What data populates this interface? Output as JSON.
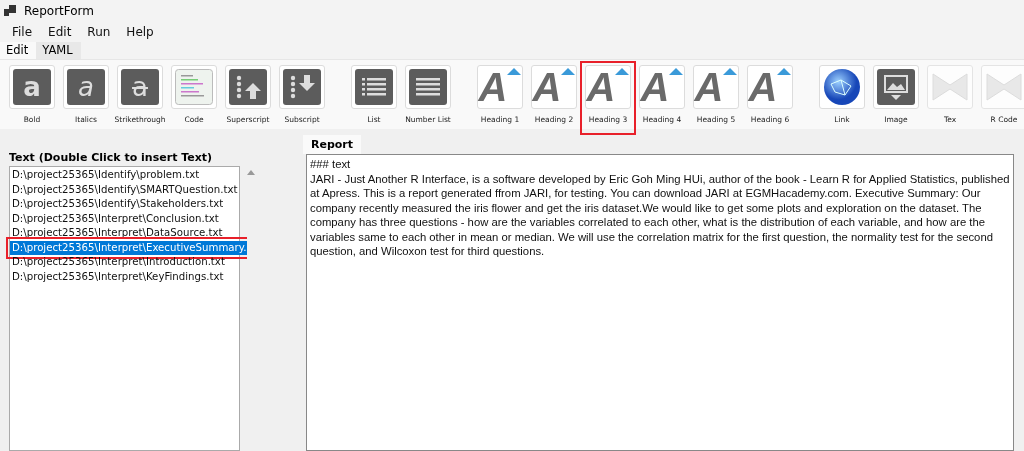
{
  "window": {
    "title": "ReportForm"
  },
  "menu": [
    "File",
    "Edit",
    "Run",
    "Help"
  ],
  "tabs": [
    {
      "label": "Edit",
      "selected": true
    },
    {
      "label": "YAML",
      "selected": false
    }
  ],
  "toolbar": [
    [
      {
        "kind": "bold",
        "glyph": "a",
        "label": "Bold",
        "highlighted": false
      },
      {
        "kind": "italic",
        "glyph": "a",
        "label": "Italics",
        "highlighted": false
      },
      {
        "kind": "strike",
        "glyph": "a",
        "label": "Strikethrough",
        "highlighted": false
      },
      {
        "kind": "code",
        "label": "Code",
        "highlighted": false
      },
      {
        "kind": "superscript",
        "label": "Superscript",
        "highlighted": false
      },
      {
        "kind": "subscript",
        "label": "Subscript",
        "highlighted": false
      }
    ],
    [
      {
        "kind": "list",
        "label": "List",
        "highlighted": false
      },
      {
        "kind": "numberlist",
        "label": "Number List",
        "highlighted": false
      }
    ],
    [
      {
        "kind": "heading",
        "glyph": "A",
        "label": "Heading 1",
        "highlighted": false
      },
      {
        "kind": "heading",
        "glyph": "A",
        "label": "Heading 2",
        "highlighted": false
      },
      {
        "kind": "heading",
        "glyph": "A",
        "label": "Heading 3",
        "highlighted": true
      },
      {
        "kind": "heading",
        "glyph": "A",
        "label": "Heading 4",
        "highlighted": false
      },
      {
        "kind": "heading",
        "glyph": "A",
        "label": "Heading 5",
        "highlighted": false
      },
      {
        "kind": "heading",
        "glyph": "A",
        "label": "Heading 6",
        "highlighted": false
      }
    ],
    [
      {
        "kind": "link",
        "label": "Link",
        "highlighted": false
      },
      {
        "kind": "image",
        "label": "Image",
        "highlighted": false
      },
      {
        "kind": "tex",
        "label": "Tex",
        "highlighted": false
      },
      {
        "kind": "tex",
        "label": "R Code",
        "highlighted": false
      }
    ]
  ],
  "text_panel": {
    "title": "Text (Double Click to insert Text)",
    "items": [
      {
        "label": "D:\\project25365\\Identify\\problem.txt",
        "selected": false,
        "highlighted": false
      },
      {
        "label": "D:\\project25365\\Identify\\SMARTQuestion.txt",
        "selected": false,
        "highlighted": false
      },
      {
        "label": "D:\\project25365\\Identify\\Stakeholders.txt",
        "selected": false,
        "highlighted": false
      },
      {
        "label": "D:\\project25365\\Interpret\\Conclusion.txt",
        "selected": false,
        "highlighted": false
      },
      {
        "label": "D:\\project25365\\Interpret\\DataSource.txt",
        "selected": false,
        "highlighted": false
      },
      {
        "label": "D:\\project25365\\Interpret\\ExecutiveSummary.",
        "selected": true,
        "highlighted": true
      },
      {
        "label": "D:\\project25365\\Interpret\\Introduction.txt",
        "selected": false,
        "highlighted": false
      },
      {
        "label": "D:\\project25365\\Interpret\\KeyFindings.txt",
        "selected": false,
        "highlighted": false
      }
    ]
  },
  "report": {
    "tab": "Report",
    "lines": [
      "### text",
      "JARI - Just Another R Interface, is a software developed by Eric Goh Ming HUi, author of the book - Learn R for Applied Statistics, published at Apress. This is a report generated ffrom JARI, for testing. You can download JARI at EGMHacademy.com. Executive Summary: Our company recently measured the iris flower and get the iris dataset.We would like to get some plots and exploration on the dataset. The company has three questions - how are the variables correlated to each other, what is the distribution of each variable, and how are the variables same to each other in mean or median. We will use the correlation matrix for the first question, the normality test for the second question, and Wilcoxon test for third questions."
    ]
  }
}
